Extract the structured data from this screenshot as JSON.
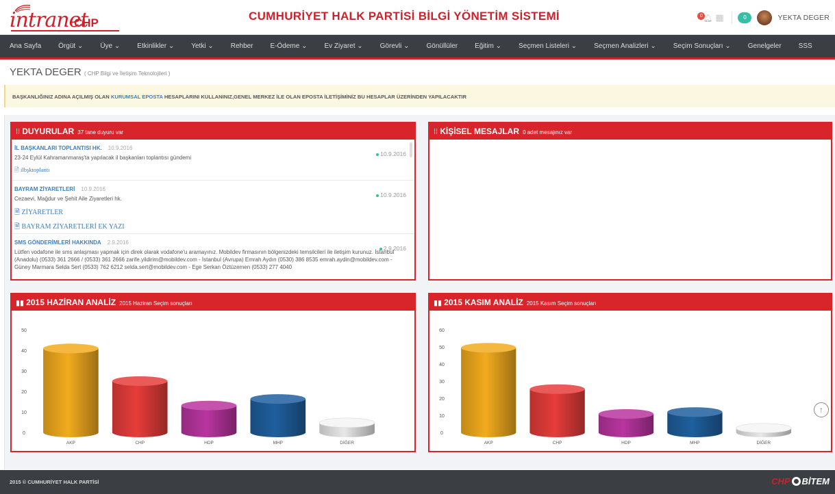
{
  "header": {
    "logo_text_main": "intranet",
    "logo_text_chp": "CHP",
    "title": "CUMHURİYET HALK PARTİSİ BİLGİ YÖNETİM SİSTEMİ",
    "notification_count": "0",
    "message_count": "0",
    "user_name": "YEKTA DEGER"
  },
  "nav": {
    "items": [
      "Ana Sayfa",
      "Örgüt ⌄",
      "Üye ⌄",
      "Etkinlikler ⌄",
      "Yetki ⌄",
      "Rehber",
      "E-Ödeme ⌄",
      "Ev Ziyaret ⌄",
      "Görevli ⌄",
      "Gönüllüler",
      "Eğitim ⌄",
      "Seçmen Listeleri ⌄",
      "Seçmen Analizleri ⌄",
      "Seçim Sonuçları ⌄",
      "Genelgeler",
      "SSS"
    ]
  },
  "page": {
    "title": "YEKTA DEGER",
    "subtitle": "( CHP Bilgi ve İletişim Teknolojileri )"
  },
  "alert": {
    "text_before": "BAŞKANLIĞINIZ ADINA AÇILMIŞ OLAN",
    "link": "KURUMSAL EPOSTA",
    "text_after": "HESAPLARINI KULLANINIZ,GENEL MERKEZ İLE OLAN EPOSTA İLETİŞİMİNİZ BU HESAPLAR ÜZERİNDEN YAPILACAKTIR"
  },
  "announcements": {
    "icon": "list-icon",
    "title": "DUYURULAR",
    "subtitle": "37 tane duyuru var",
    "items": [
      {
        "title": "İL BAŞKANLARI TOPLANTISI HK.",
        "date": "10.9.2016",
        "desc": "23-24 Eylül Kahramanmaraş'ta yapılacak il başkanları toplantısı gündemi",
        "files": [
          "ilbşktoplantı"
        ],
        "right_date": "10.9.2016"
      },
      {
        "title": "BAYRAM ZİYARETLERİ",
        "date": "10.9.2016",
        "desc": "Cezaevi, Mağdur ve Şehit Aile Ziyaretleri hk.",
        "files": [
          "ZİYARETLER",
          "BAYRAM ZİYARETLERİ EK YAZI"
        ],
        "right_date": "10.9.2016"
      },
      {
        "title": "SMS GÖNDERİMLERİ HAKKINDA",
        "date": "2.9.2016",
        "desc": "Lütfen vodafone ile sms anlaşması yapmak için direk olarak vodafone'u aramayınız. Mobildev firmasının bölgenizdeki temsilcileri ile iletişim kurunuz. İstanbul (Anadolu) (0533) 361 2666 / (0533) 361 2666 zarife.yildirim@mobildev.com - İstanbul (Avrupa) Emrah Aydın (0530) 386 8535 emrah.aydin@mobildev.com - Güney Marmara Selda Sert (0533) 762 6212 selda.sert@mobildev.com - Ege Serkan Öztüzemen (0533) 277 4040",
        "files": [],
        "right_date": "2.9.2016"
      }
    ]
  },
  "messages": {
    "icon": "list-icon",
    "title": "KİŞİSEL MESAJLAR",
    "subtitle": "0 adet mesajınız var"
  },
  "chart_june": {
    "icon": "bar-chart-icon",
    "title": "2015 HAZİRAN ANALİZ",
    "subtitle": "2015 Haziran Seçim sonuçları"
  },
  "chart_nov": {
    "icon": "bar-chart-icon",
    "title": "2015 KASIM ANALİZ",
    "subtitle": "2015 Kasım Seçim sonuçları"
  },
  "chart_data": [
    {
      "type": "bar",
      "title": "2015 HAZİRAN ANALİZ",
      "categories": [
        "AKP",
        "CHP",
        "HDP",
        "MHP",
        "DİĞER"
      ],
      "values": [
        40.9,
        25.0,
        13.1,
        16.3,
        4.7
      ],
      "colors": [
        "#f2ab1e",
        "#e53d3a",
        "#b8359f",
        "#1f5f9e",
        "#e8e8e8"
      ],
      "yticks": [
        0,
        10,
        20,
        30,
        40,
        50
      ],
      "ylim": [
        0,
        50
      ]
    },
    {
      "type": "bar",
      "title": "2015 KASIM ANALİZ",
      "categories": [
        "AKP",
        "CHP",
        "HDP",
        "MHP",
        "DİĞER"
      ],
      "values": [
        49.5,
        25.3,
        10.8,
        11.9,
        2.5
      ],
      "colors": [
        "#f2ab1e",
        "#e53d3a",
        "#b8359f",
        "#1f5f9e",
        "#e8e8e8"
      ],
      "yticks": [
        0,
        10,
        20,
        30,
        40,
        50,
        60
      ],
      "ylim": [
        0,
        60
      ]
    }
  ],
  "footer": {
    "copyright": "2015 © CUMHURİYET HALK PARTİSİ",
    "brand_left": "CHP",
    "brand_right": "BİTEM"
  },
  "scroll_top": "↑"
}
